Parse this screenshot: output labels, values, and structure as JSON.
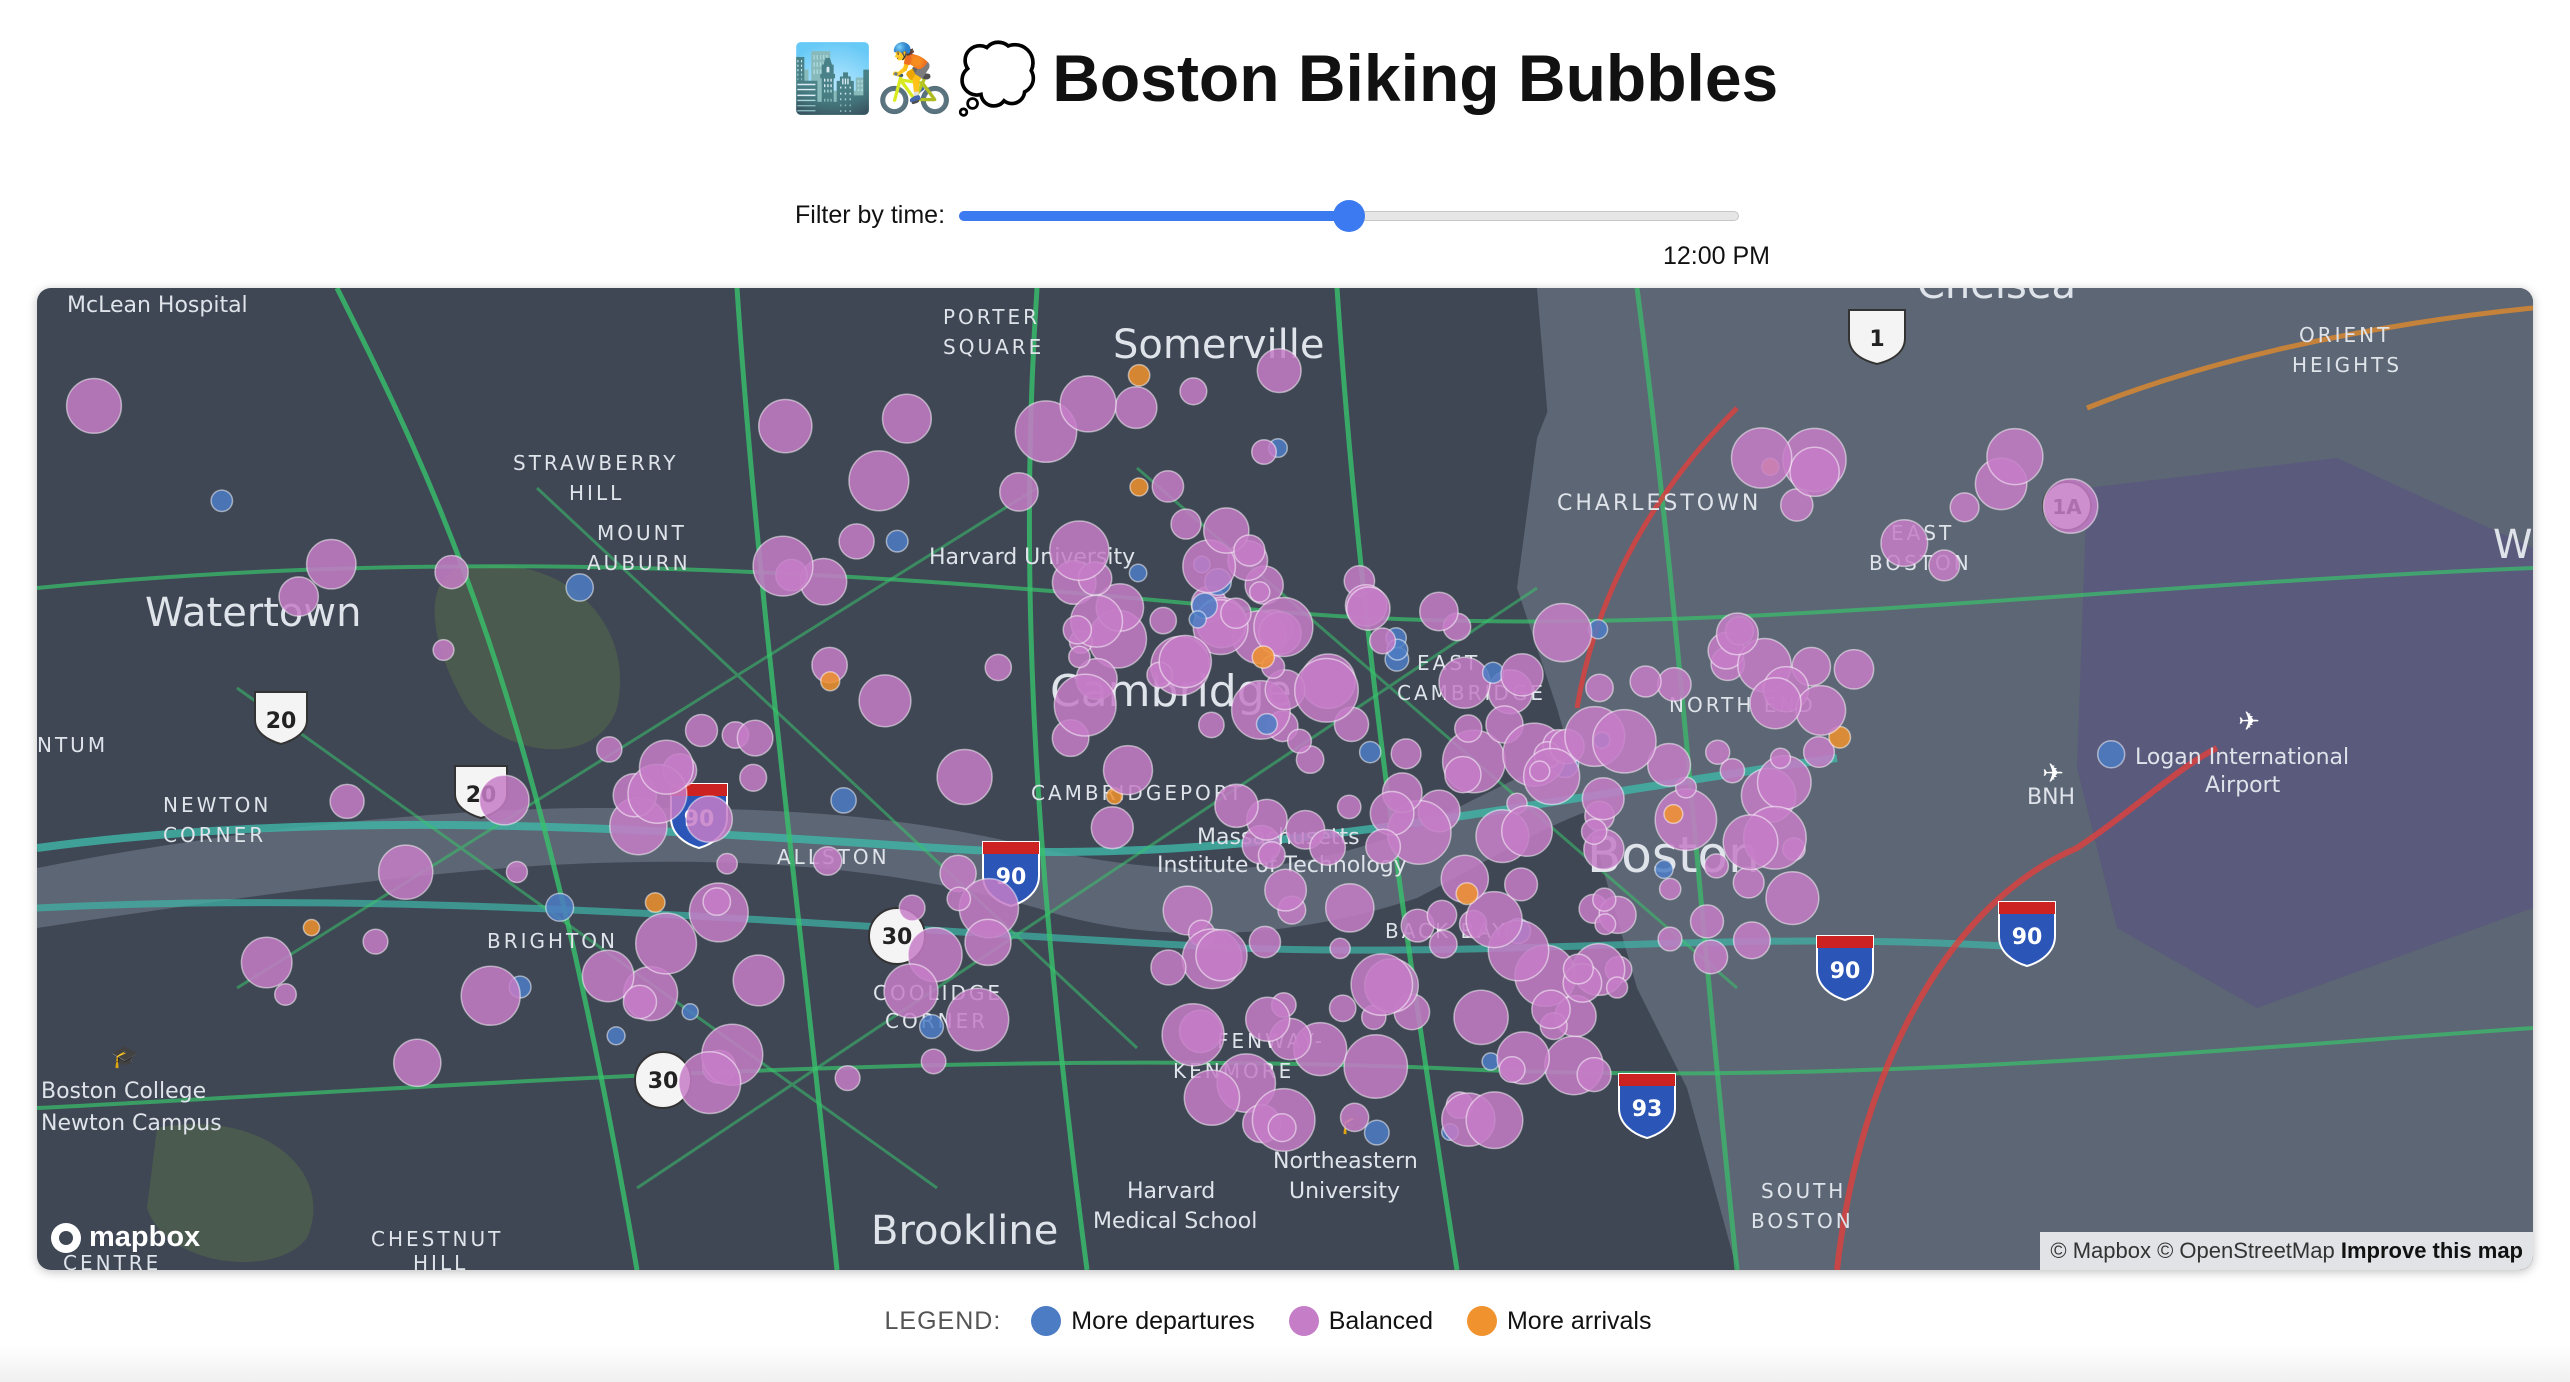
{
  "page": {
    "title_emoji": "🏙️🚴💭",
    "title": "Boston Biking Bubbles"
  },
  "filter": {
    "label": "Filter by time:",
    "value_fraction": 0.5,
    "time_readout": "12:00 PM"
  },
  "map": {
    "place_labels": [
      "McLean Hospital",
      "PORTER",
      "SQUARE",
      "Somerville",
      "Chelsea",
      "ORIENT",
      "HEIGHTS",
      "STRAWBERRY",
      "HILL",
      "MOUNT",
      "AUBURN",
      "CHARLESTOWN",
      "EAST",
      "BOSTON",
      "Harvard University",
      "Watertown",
      "Cambridge",
      "EAST",
      "CAMBRIDGE",
      "NORTH END",
      "Logan International",
      "Airport",
      "BNH",
      "NEWTON",
      "CORNER",
      "CAMBRIDGEPORT",
      "Massachusetts",
      "Institute of Technology",
      "Boston",
      "ALLSTON",
      "BRIGHTON",
      "COOLIDGE",
      "CORNER",
      "BACK BAY",
      "FENWAY-",
      "KENMORE",
      "Boston College",
      "Newton Campus",
      "Northeastern",
      "University",
      "Harvard",
      "Medical School",
      "SOUTH",
      "BOSTON",
      "CHESTNUT",
      "HILL",
      "Brookline",
      "CENTRE",
      "NTUM",
      "W"
    ],
    "route_shields": [
      "1",
      "1A",
      "20",
      "20",
      "90",
      "90",
      "90",
      "90",
      "30",
      "30",
      "93"
    ],
    "logo_text": "mapbox",
    "attribution": "© Mapbox © OpenStreetMap",
    "improve_link": "Improve this map",
    "colors": {
      "water": "#5d6674",
      "land": "#3f4654",
      "departures": "#4c7cc4",
      "balanced": "#c67dc7",
      "arrivals": "#f0922e"
    }
  },
  "legend": {
    "title": "LEGEND:",
    "items": [
      {
        "label": "More departures",
        "color": "#4c7cc4"
      },
      {
        "label": "Balanced",
        "color": "#c67dc7"
      },
      {
        "label": "More arrivals",
        "color": "#f0922e"
      }
    ]
  }
}
